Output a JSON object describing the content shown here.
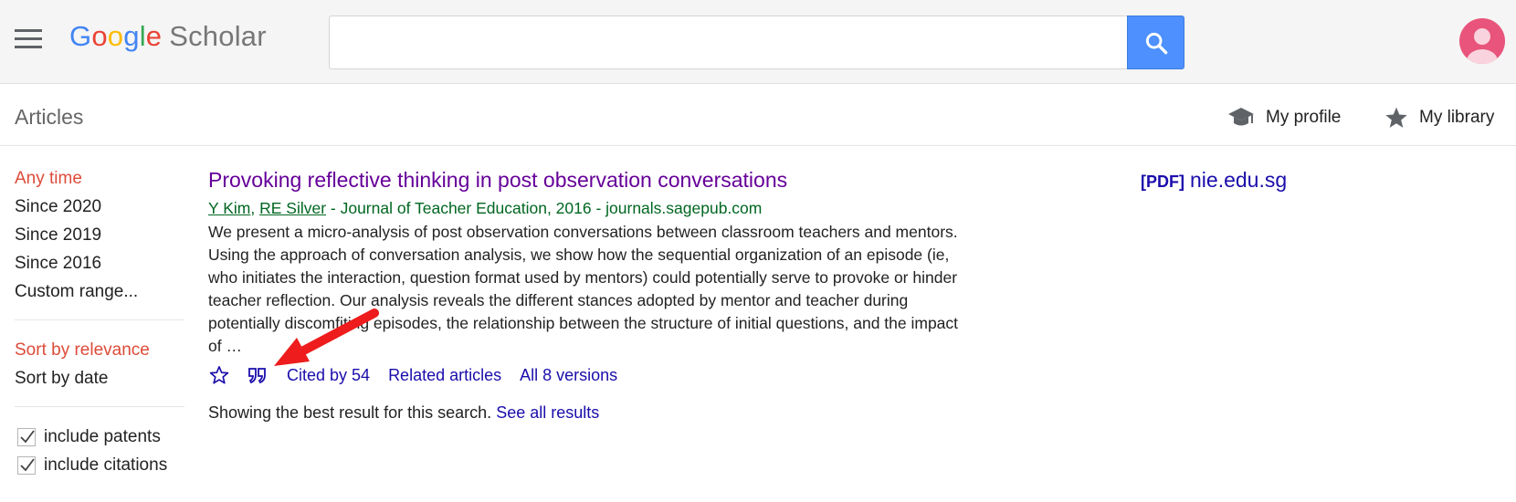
{
  "header": {
    "logo_google": [
      "G",
      "o",
      "o",
      "g",
      "l",
      "e"
    ],
    "logo_scholar": "Scholar",
    "search": {
      "value": "",
      "placeholder": ""
    },
    "icons": {
      "menu": "menu-icon",
      "search": "search-icon",
      "avatar": "avatar-icon"
    }
  },
  "subbar": {
    "articles_label": "Articles",
    "my_profile": "My profile",
    "my_library": "My library",
    "icons": {
      "profile": "graduation-cap-icon",
      "library": "star-icon"
    }
  },
  "sidebar": {
    "time_filters": [
      {
        "label": "Any time",
        "active": true
      },
      {
        "label": "Since 2020",
        "active": false
      },
      {
        "label": "Since 2019",
        "active": false
      },
      {
        "label": "Since 2016",
        "active": false
      },
      {
        "label": "Custom range...",
        "active": false
      }
    ],
    "sort_options": [
      {
        "label": "Sort by relevance",
        "active": true
      },
      {
        "label": "Sort by date",
        "active": false
      }
    ],
    "checkboxes": [
      {
        "label": "include patents",
        "checked": true
      },
      {
        "label": "include citations",
        "checked": true
      }
    ]
  },
  "result": {
    "title": "Provoking reflective thinking in post observation conversations",
    "authors": [
      "Y Kim",
      "RE Silver"
    ],
    "author_sep": ", ",
    "source": " - Journal of Teacher Education, 2016 - journals.sagepub.com",
    "snippet": "We present a micro-analysis of post observation conversations between classroom teachers and mentors. Using the approach of conversation analysis, we show how the sequential organization of an episode (ie, who initiates the interaction, question format used by mentors) could potentially serve to provoke or hinder teacher reflection. Our analysis reveals the different stances adopted by mentor and teacher during potentially discomfiting episodes, the relationship between the structure of initial questions, and the impact of …",
    "cited_by": "Cited by 54",
    "related": "Related articles",
    "versions": "All 8 versions",
    "note": "Showing the best result for this search.",
    "see_all": "See all results",
    "icons": {
      "save": "star-outline-icon",
      "cite": "quote-icon"
    }
  },
  "pdf": {
    "tag": "[PDF]",
    "domain": "nie.edu.sg"
  },
  "colors": {
    "header_bg": "#f5f5f5",
    "search_button": "#4d90fe",
    "active_filter": "#dd4b39",
    "link_blue": "#1a0dab",
    "visited_purple": "#660099",
    "meta_green": "#006621",
    "annotation_arrow": "#ee1c1c"
  }
}
